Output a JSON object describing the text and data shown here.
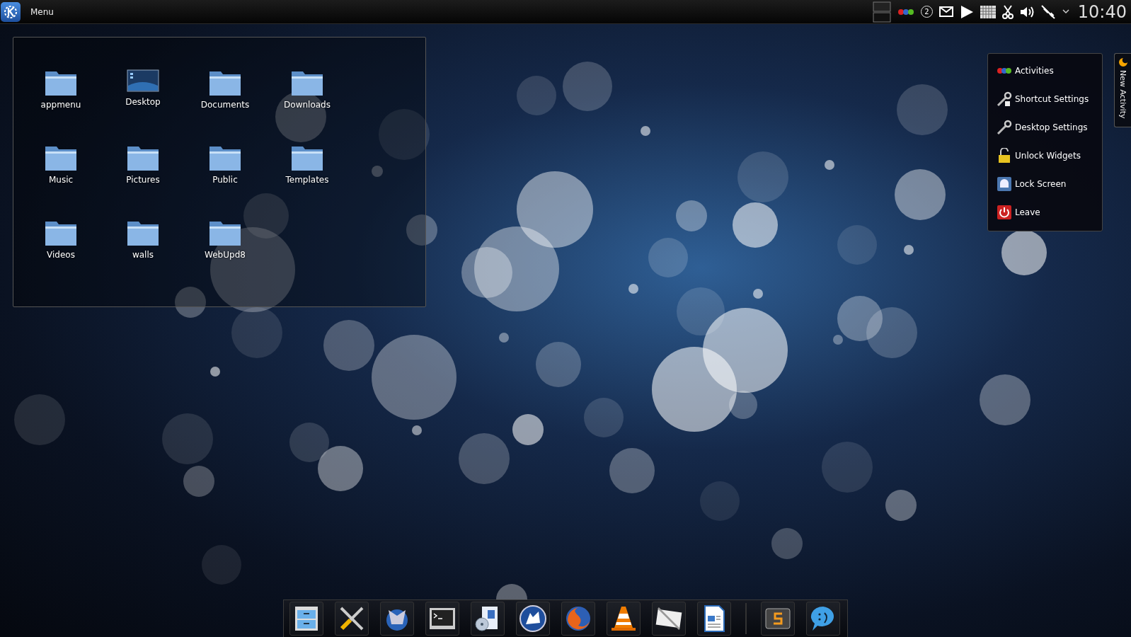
{
  "top_panel": {
    "menu_label": "Menu",
    "tray": [
      {
        "kind": "pager"
      },
      {
        "kind": "activities"
      },
      {
        "kind": "badge",
        "text": "2"
      },
      {
        "kind": "mail"
      },
      {
        "kind": "play"
      },
      {
        "kind": "keyboard"
      },
      {
        "kind": "scissors"
      },
      {
        "kind": "volume"
      },
      {
        "kind": "network"
      },
      {
        "kind": "caret"
      }
    ],
    "clock": "10:40"
  },
  "folder_view": {
    "items": [
      {
        "label": "appmenu",
        "kind": "folder"
      },
      {
        "label": "Desktop",
        "kind": "desktop"
      },
      {
        "label": "Documents",
        "kind": "folder"
      },
      {
        "label": "Downloads",
        "kind": "folder"
      },
      {
        "label": "Music",
        "kind": "folder"
      },
      {
        "label": "Pictures",
        "kind": "folder"
      },
      {
        "label": "Public",
        "kind": "folder"
      },
      {
        "label": "Templates",
        "kind": "folder"
      },
      {
        "label": "Videos",
        "kind": "folder"
      },
      {
        "label": "walls",
        "kind": "folder"
      },
      {
        "label": "WebUpd8",
        "kind": "folder"
      }
    ]
  },
  "toolbox_menu": {
    "items": [
      {
        "label": "Activities",
        "kind": "activities"
      },
      {
        "label": "Shortcut Settings",
        "kind": "shortcut"
      },
      {
        "label": "Desktop Settings",
        "kind": "wrench"
      },
      {
        "label": "Unlock Widgets",
        "kind": "unlock"
      },
      {
        "label": "Lock Screen",
        "kind": "lock"
      },
      {
        "label": "Leave",
        "kind": "leave"
      }
    ]
  },
  "new_activity_tab": {
    "label": "New Activity"
  },
  "dock": {
    "launchers": [
      {
        "kind": "cabinet"
      },
      {
        "kind": "tools"
      },
      {
        "kind": "robot-globe"
      },
      {
        "kind": "terminal"
      },
      {
        "kind": "software-box"
      },
      {
        "kind": "wolf-globe"
      },
      {
        "kind": "fox-globe"
      },
      {
        "kind": "cone"
      },
      {
        "kind": "envelope"
      },
      {
        "kind": "document"
      }
    ],
    "tasks": [
      {
        "kind": "s-block"
      },
      {
        "kind": "chat-bubble"
      }
    ]
  }
}
